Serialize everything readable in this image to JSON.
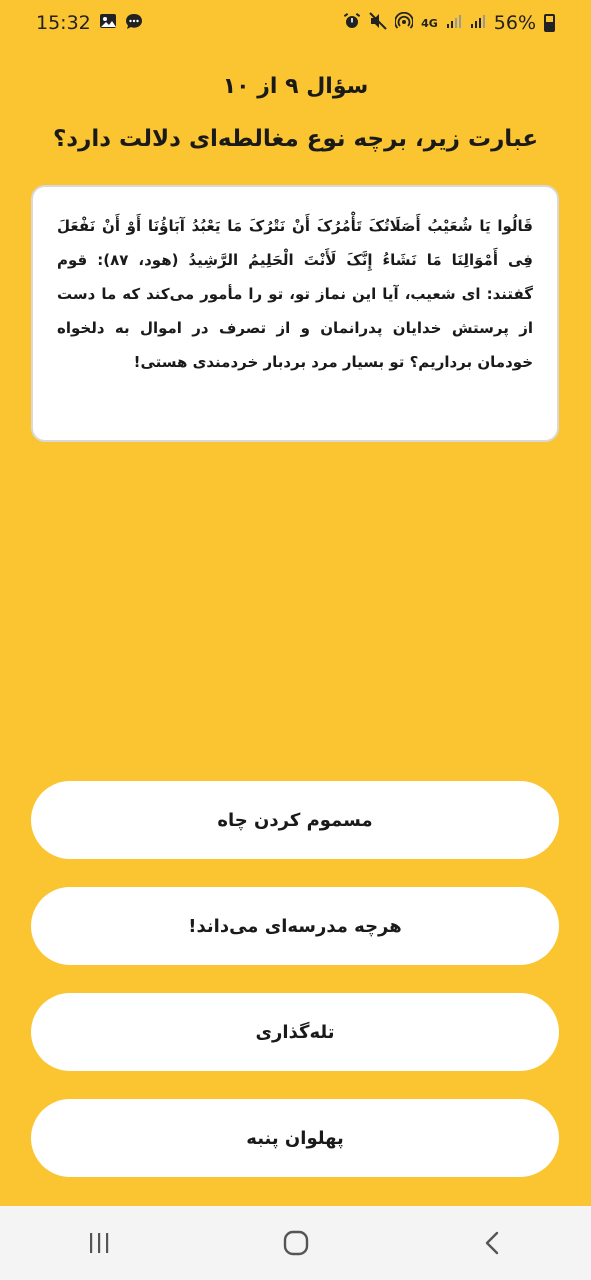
{
  "status_bar": {
    "time": "15:32",
    "network": "4G",
    "battery": "56%",
    "left_icons": [
      "gallery-icon",
      "chat-icon"
    ],
    "right_icons": [
      "alarm-icon",
      "mute-icon",
      "hotspot-icon",
      "signal-icon",
      "signal-icon",
      "battery-icon"
    ]
  },
  "quiz": {
    "counter": "سؤال ۹ از ۱۰",
    "question": "عبارت زیر، برچه نوع مغالطه‌ای دلالت دارد؟",
    "passage": "قَالُوا یَا شُعَیْبُ أَصَلَاتُکَ تَأْمُرُکَ أَنْ نَتْرُکَ مَا یَعْبُدُ آبَاؤُنَا أَوْ أَنْ نَفْعَلَ فِی أَمْوَالِنَا مَا نَشَاءُ إِنَّکَ لَأَنْتَ الْحَلِیمُ الرَّشِیدُ (هود، ۸۷): قوم گفتند: ای شعیب، آیا این نماز تو، تو را مأمور می‌کند که ما دست از پرستش خدایان پدرانمان و از تصرف در اموال به دلخواه خودمان برداریم؟ تو بسیار مرد بردبار خردمندی هستی!",
    "options": [
      "مسموم کردن چاه",
      "هرچه مدرسه‌ای می‌داند!",
      "تله‌گذاری",
      "پهلوان پنبه"
    ]
  },
  "nav": {
    "icons": [
      "recent-apps-icon",
      "home-icon",
      "back-icon"
    ]
  },
  "colors": {
    "background": "#FBC531",
    "card": "#FFFFFF",
    "nav": "#F4F4F4"
  }
}
